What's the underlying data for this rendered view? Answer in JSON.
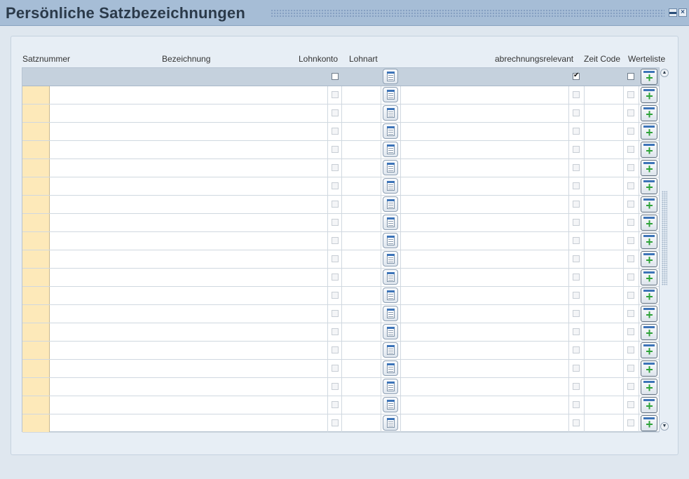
{
  "window": {
    "title": "Persönliche Satzbezeichnungen",
    "minimize_icon": "minimize-icon",
    "close_icon": "close-icon"
  },
  "columns": {
    "satznummer": "Satznummer",
    "bezeichnung": "Bezeichnung",
    "lohnkonto": "Lohnkonto",
    "lohnart": "Lohnart",
    "abrechnungsrelevant": "abrechnungsrelevant",
    "zeit_code": "Zeit Code",
    "werteliste": "Werteliste"
  },
  "filter_row": {
    "lohnkonto_checked": false,
    "abrechnungsrelevant_checked": true,
    "werteliste_checked": false
  },
  "rows": [
    {
      "satznummer": "",
      "bezeichnung": "",
      "lohnart": "",
      "zeit_code": ""
    },
    {
      "satznummer": "",
      "bezeichnung": "",
      "lohnart": "",
      "zeit_code": ""
    },
    {
      "satznummer": "",
      "bezeichnung": "",
      "lohnart": "",
      "zeit_code": ""
    },
    {
      "satznummer": "",
      "bezeichnung": "",
      "lohnart": "",
      "zeit_code": ""
    },
    {
      "satznummer": "",
      "bezeichnung": "",
      "lohnart": "",
      "zeit_code": ""
    },
    {
      "satznummer": "",
      "bezeichnung": "",
      "lohnart": "",
      "zeit_code": ""
    },
    {
      "satznummer": "",
      "bezeichnung": "",
      "lohnart": "",
      "zeit_code": ""
    },
    {
      "satznummer": "",
      "bezeichnung": "",
      "lohnart": "",
      "zeit_code": ""
    },
    {
      "satznummer": "",
      "bezeichnung": "",
      "lohnart": "",
      "zeit_code": ""
    },
    {
      "satznummer": "",
      "bezeichnung": "",
      "lohnart": "",
      "zeit_code": ""
    },
    {
      "satznummer": "",
      "bezeichnung": "",
      "lohnart": "",
      "zeit_code": ""
    },
    {
      "satznummer": "",
      "bezeichnung": "",
      "lohnart": "",
      "zeit_code": ""
    },
    {
      "satznummer": "",
      "bezeichnung": "",
      "lohnart": "",
      "zeit_code": ""
    },
    {
      "satznummer": "",
      "bezeichnung": "",
      "lohnart": "",
      "zeit_code": ""
    },
    {
      "satznummer": "",
      "bezeichnung": "",
      "lohnart": "",
      "zeit_code": ""
    },
    {
      "satznummer": "",
      "bezeichnung": "",
      "lohnart": "",
      "zeit_code": ""
    },
    {
      "satznummer": "",
      "bezeichnung": "",
      "lohnart": "",
      "zeit_code": ""
    },
    {
      "satznummer": "",
      "bezeichnung": "",
      "lohnart": "",
      "zeit_code": ""
    },
    {
      "satznummer": "",
      "bezeichnung": "",
      "lohnart": "",
      "zeit_code": ""
    }
  ],
  "colors": {
    "titlebar": "#a6bdd6",
    "key_column": "#fde9b9",
    "filter_row": "#c5d1dd",
    "add_icon": "#2fa33a"
  }
}
